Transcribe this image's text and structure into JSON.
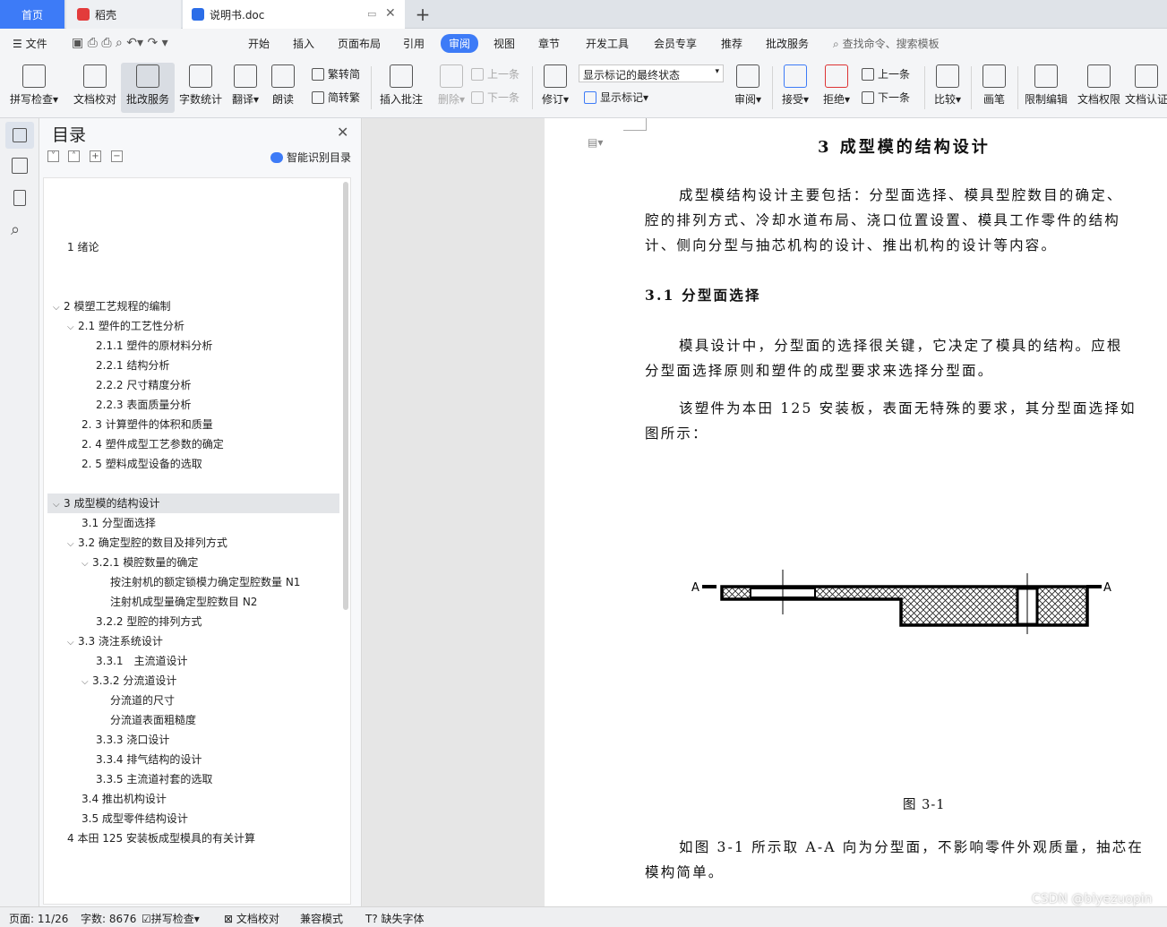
{
  "tabs": {
    "home": "首页",
    "daoke": "稻壳",
    "doc": "说明书.doc",
    "colors": {
      "home_bg": "#3d7bf7",
      "daoke_icon": "#e33b3b",
      "doc_icon": "#2b6de8"
    }
  },
  "menu": {
    "file": "文件",
    "items": [
      "开始",
      "插入",
      "页面布局",
      "引用",
      "审阅",
      "视图",
      "章节",
      "开发工具",
      "会员专享",
      "推荐",
      "批改服务"
    ],
    "active": "审阅",
    "search": "查找命令、搜索模板"
  },
  "toolbar": {
    "spell": "拼写检查",
    "doc_check": "文档校对",
    "correction": "批改服务",
    "word_count": "字数统计",
    "translate": "翻译",
    "read_aloud": "朗读",
    "trad": "繁转简",
    "simp": "简转繁",
    "insert_comment": "插入批注",
    "delete": "删除",
    "prev": "上一条",
    "next": "下一条",
    "track": "修订",
    "markup_state": "显示标记的最终状态",
    "show_markup": "显示标记",
    "review": "审阅",
    "accept": "接受",
    "reject": "拒绝",
    "prev2": "上一条",
    "next2": "下一条",
    "compare": "比较",
    "pen": "画笔",
    "restrict": "限制编辑",
    "permission": "文档权限",
    "cert": "文档认证"
  },
  "toc": {
    "title": "目录",
    "smart": "智能识别目录",
    "items": [
      "1 绪论",
      "2 模塑工艺规程的编制",
      "2.1 塑件的工艺性分析",
      "2.1.1 塑件的原材料分析",
      "2.2.1 结构分析",
      "2.2.2 尺寸精度分析",
      "2.2.3 表面质量分析",
      "2. 3 计算塑件的体积和质量",
      "2. 4 塑件成型工艺参数的确定",
      "2. 5 塑料成型设备的选取",
      "3 成型模的结构设计",
      "3.1 分型面选择",
      "3.2 确定型腔的数目及排列方式",
      "3.2.1 模腔数量的确定",
      "按注射机的额定锁模力确定型腔数量 N1",
      "注射机成型量确定型腔数目 N2",
      "3.2.2 型腔的排列方式",
      "3.3 浇注系统设计",
      "3.3.1　主流道设计",
      "3.3.2 分流道设计",
      "分流道的尺寸",
      "分流道表面粗糙度",
      "3.3.3 浇口设计",
      "3.3.4 排气结构的设计",
      "3.3.5 主流道衬套的选取",
      "3.4 推出机构设计",
      "3.5 成型零件结构设计",
      "4 本田 125 安装板成型模具的有关计算"
    ]
  },
  "doc": {
    "chapter": "3 成型模的结构设计",
    "p1a": "成型模结构设计主要包括：分型面选择、模具型腔数目的确定、",
    "p1b": "腔的排列方式、冷却水道布局、浇口位置设置、模具工作零件的结构",
    "p1c": "计、侧向分型与抽芯机构的设计、推出机构的设计等内容。",
    "sec": "3.1 分型面选择",
    "p2a": "模具设计中，分型面的选择很关键，它决定了模具的结构。应根",
    "p2b": "分型面选择原则和塑件的成型要求来选择分型面。",
    "p3a": "该塑件为本田 125 安装板，表面无特殊的要求，其分型面选择如",
    "p3b": "图所示：",
    "fig_label_left": "A",
    "fig_label_right": "A",
    "caption": "图 3-1",
    "p4a": "如图 3-1 所示取 A-A 向为分型面，不影响零件外观质量，抽芯在",
    "p4b": "模构简单。"
  },
  "status": {
    "page": "页面: 11/26",
    "words": "字数: 8676",
    "spell": "拼写检查",
    "doc_check": "文档校对",
    "compat": "兼容模式",
    "missing_font": "缺失字体"
  },
  "watermark": "CSDN @biyezuopin"
}
